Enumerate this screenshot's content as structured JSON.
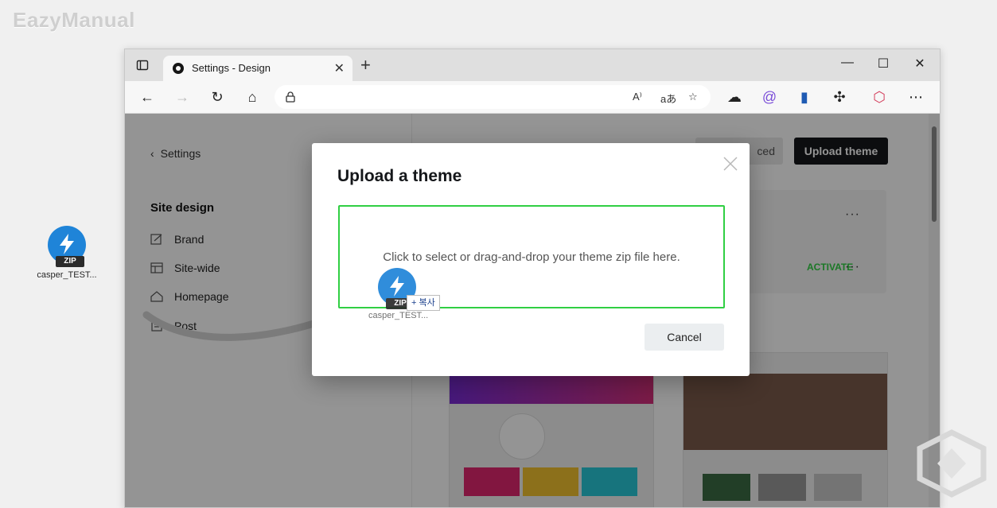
{
  "watermark": "EazyManual",
  "desktop": {
    "file_label": "casper_TEST..."
  },
  "browser": {
    "tab_title": "Settings - Design",
    "window_controls": {
      "minimize": "—",
      "maximize": "☐",
      "close": "✕"
    }
  },
  "sidebar": {
    "back_label": "Settings",
    "section_title": "Site design",
    "items": [
      {
        "label": "Brand",
        "icon": "brush-icon"
      },
      {
        "label": "Site-wide",
        "icon": "layout-icon"
      },
      {
        "label": "Homepage",
        "icon": "home-icon"
      },
      {
        "label": "Post",
        "icon": "document-icon"
      }
    ]
  },
  "main": {
    "advanced_label": "ced",
    "upload_button": "Upload theme",
    "activate_label": "ACTIVATE",
    "more_label": "···"
  },
  "modal": {
    "title": "Upload a theme",
    "dropzone_text": "Click to select or drag-and-drop your theme zip file here.",
    "cancel_label": "Cancel",
    "accent": "#30cf43"
  },
  "drag": {
    "file_label": "casper_TEST...",
    "copy_badge": "+ 복사",
    "zip_label": "ZIP"
  }
}
